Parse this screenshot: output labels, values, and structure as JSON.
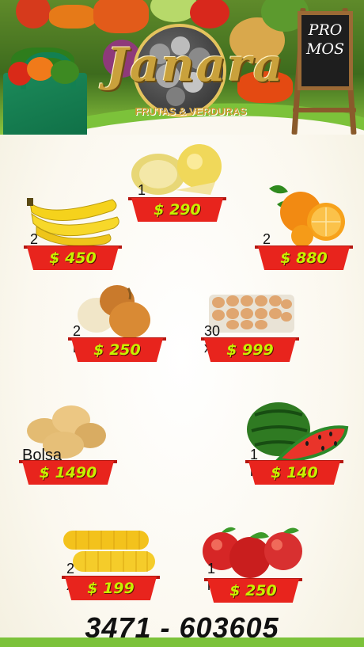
{
  "brand": {
    "name": "Janara",
    "subtitle": "FRUTAS & VERDURAS",
    "board_line1": "PRO",
    "board_line2": "MOS"
  },
  "products": [
    {
      "name": "melon",
      "qty": "1 kl",
      "price": "$ 290"
    },
    {
      "name": "banana",
      "qty": "2 kl",
      "price": "$ 450"
    },
    {
      "name": "orange",
      "qty": "2 kl",
      "price": "$ 880"
    },
    {
      "name": "onion",
      "qty": "2 kl",
      "price": "$ 250"
    },
    {
      "name": "eggs",
      "qty": "30 x",
      "price": "$ 999"
    },
    {
      "name": "potatoes",
      "qty": "Bolsa",
      "price": "$ 1490"
    },
    {
      "name": "watermelon",
      "qty": "1 kl",
      "price": "$ 140"
    },
    {
      "name": "corn",
      "qty": "2 x",
      "price": "$ 199"
    },
    {
      "name": "apple",
      "qty": "1 kl",
      "price": "$ 250"
    }
  ],
  "contact": {
    "phone": "3471 - 603605"
  },
  "colors": {
    "banner": "#e8241d",
    "price_text": "#c8f000",
    "accent_green": "#7cc23a",
    "gold": "#c9a13c"
  },
  "icons": [
    "shopping-bag-icon",
    "chalkboard-icon",
    "logo-emblem-icon"
  ]
}
